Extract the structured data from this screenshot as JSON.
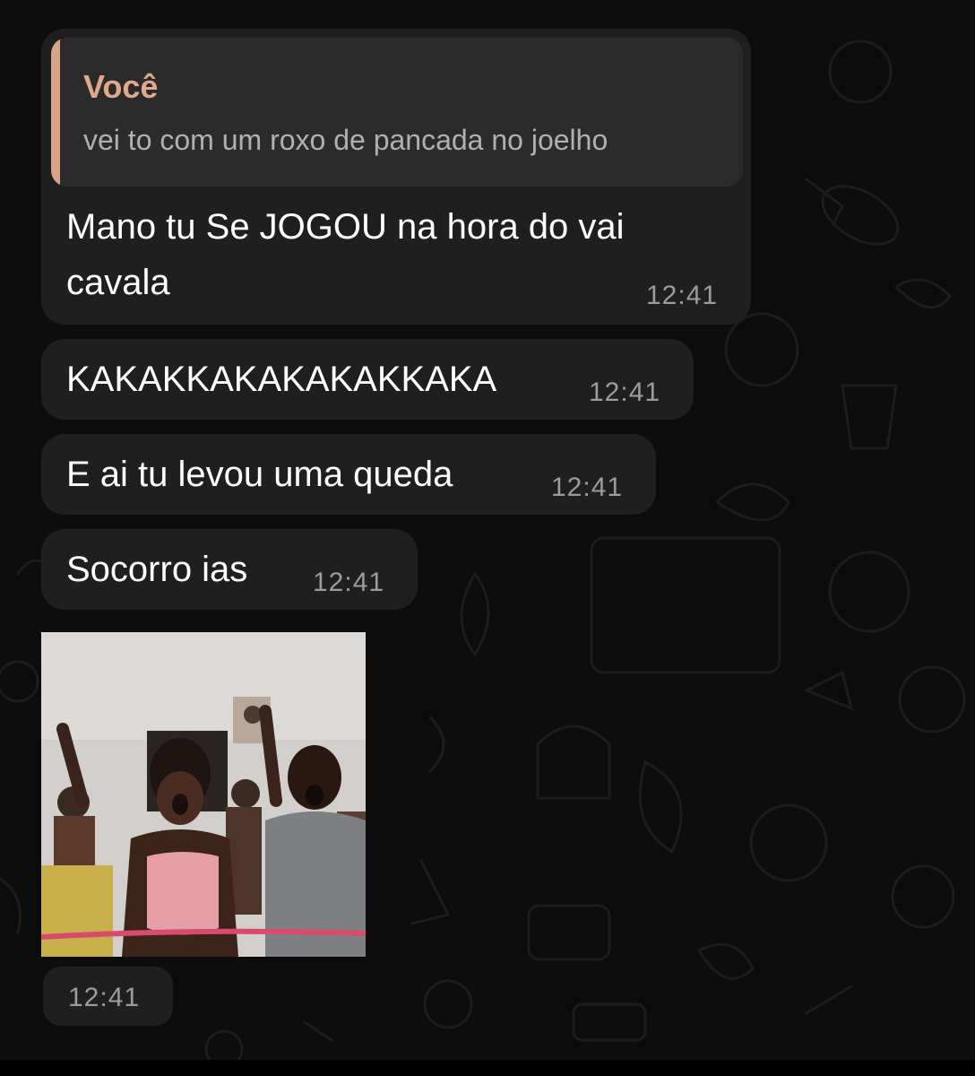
{
  "chat": {
    "reply_bubble": {
      "quote_author": "Você",
      "quote_text": "vei to com um roxo de pancada no joelho",
      "line1": "Mano tu Se JOGOU na hora do vai",
      "line2": "cavala",
      "time": "12:41"
    },
    "messages": [
      {
        "text": "KAKAKKAKAKAKAKKAKA",
        "time": "12:41"
      },
      {
        "text": "E ai tu levou uma queda",
        "time": "12:41"
      },
      {
        "text": "Socorro ias",
        "time": "12:41"
      }
    ],
    "media_message": {
      "description": "video-thumbnail",
      "time": "12:41"
    }
  },
  "colors": {
    "bubble": "#1f1f1f",
    "quote_bar": "#d9a387",
    "quote_author": "#e0a98c",
    "background": "#0c0c0c"
  }
}
